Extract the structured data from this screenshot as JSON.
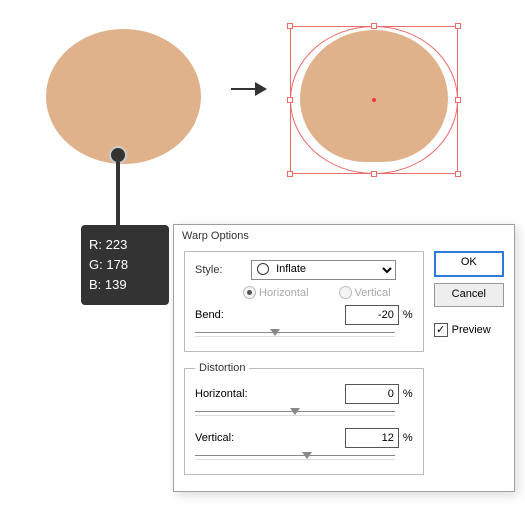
{
  "colors": {
    "shape": "#dfb28b",
    "selection": "#ec6b6b"
  },
  "color_readout": {
    "r_label": "R:",
    "r_value": "223",
    "g_label": "G:",
    "g_value": "178",
    "b_label": "B:",
    "b_value": "139"
  },
  "dialog": {
    "title": "Warp Options",
    "style_label": "Style:",
    "style_value": "Inflate",
    "orientation": {
      "horizontal": "Horizontal",
      "vertical": "Vertical",
      "selected": "horizontal"
    },
    "bend": {
      "label": "Bend:",
      "value": "-20",
      "percent": "%"
    },
    "distortion": {
      "legend": "Distortion",
      "horizontal_label": "Horizontal:",
      "horizontal_value": "0",
      "vertical_label": "Vertical:",
      "vertical_value": "12",
      "percent": "%"
    },
    "ok": "OK",
    "cancel": "Cancel",
    "preview": "Preview",
    "preview_checked": true
  }
}
